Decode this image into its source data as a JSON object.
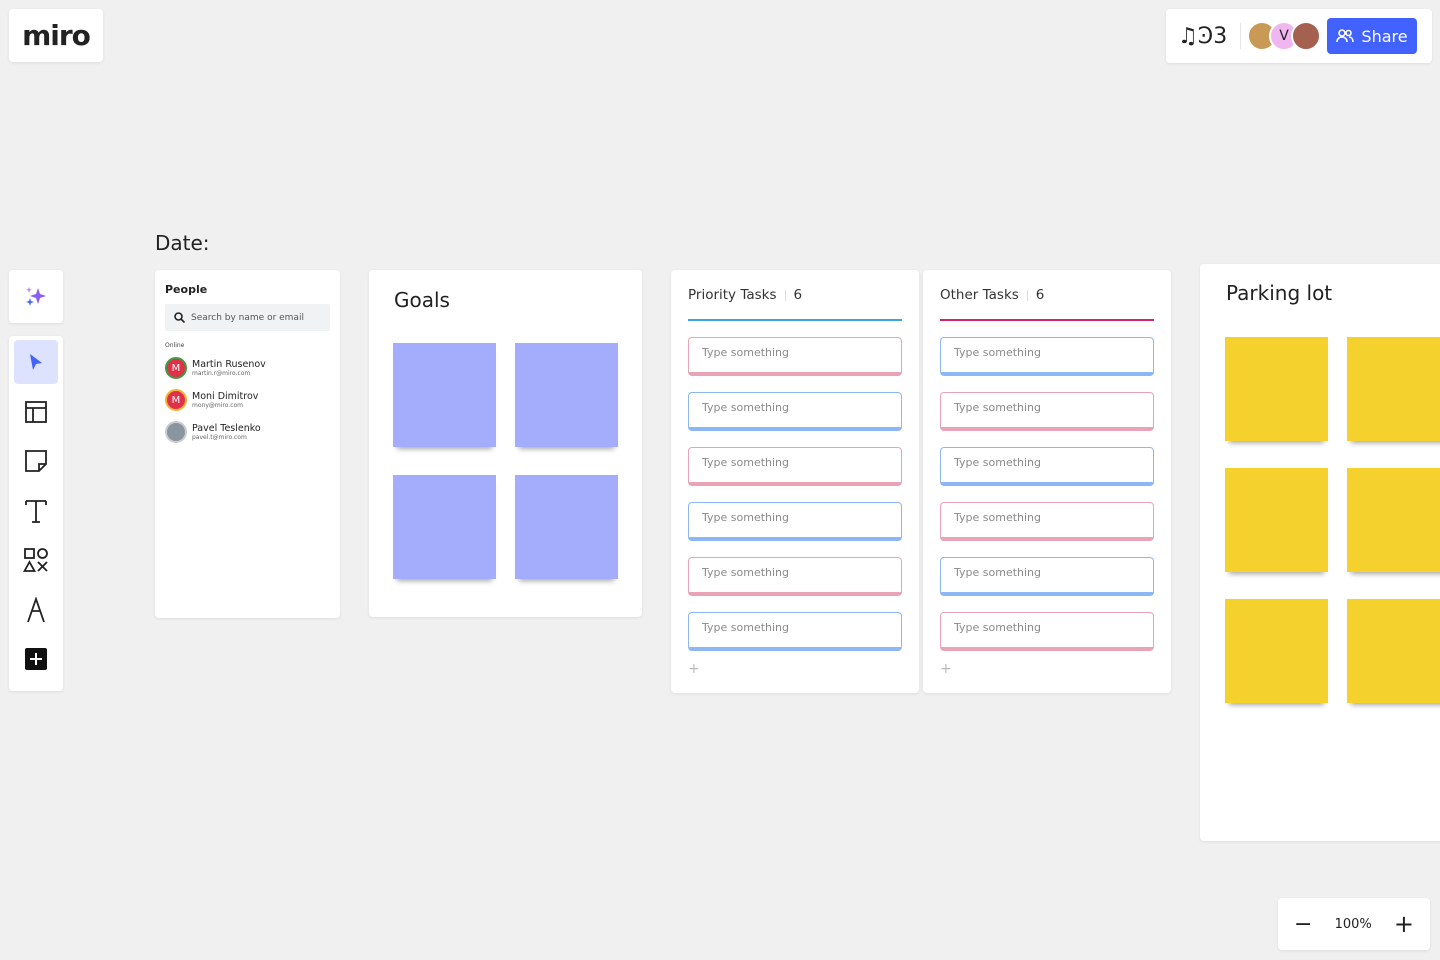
{
  "logo": "miro",
  "header": {
    "board_icon": "music-notes-board-icon",
    "avatars": [
      {
        "initial": "",
        "color": "#c99a55"
      },
      {
        "initial": "V",
        "color": "#f0b6f0"
      },
      {
        "initial": "",
        "color": "#a4614f"
      }
    ],
    "share_label": "Share",
    "accent": "#4262ff"
  },
  "toolbar": {
    "items": [
      "select",
      "templates",
      "sticky-note",
      "text",
      "shapes",
      "pen",
      "add"
    ]
  },
  "date_label": "Date:",
  "people": {
    "title": "People",
    "search_placeholder": "Search by name or email",
    "section": "Online",
    "members": [
      {
        "initial": "M",
        "name": "Martin Rusenov",
        "email": "martin.r@miro.com",
        "ring": "#3f9b3f"
      },
      {
        "initial": "M",
        "name": "Moni Dimitrov",
        "email": "mony@miro.com",
        "ring": "#f2b533"
      },
      {
        "initial": "",
        "name": "Pavel Teslenko",
        "email": "pavel.t@miro.com",
        "ring": "#ccc"
      }
    ]
  },
  "goals": {
    "title": "Goals",
    "sticky_color": "#a3adfb"
  },
  "columns": [
    {
      "title": "Priority Tasks",
      "count": "6",
      "line_color": "#3aa8e0",
      "cards": [
        {
          "text": "Type something",
          "color": "pink"
        },
        {
          "text": "Type something",
          "color": "blue"
        },
        {
          "text": "Type something",
          "color": "pink"
        },
        {
          "text": "Type something",
          "color": "blue"
        },
        {
          "text": "Type something",
          "color": "pink"
        },
        {
          "text": "Type something",
          "color": "blue"
        }
      ],
      "add": "+"
    },
    {
      "title": "Other Tasks",
      "count": "6",
      "line_color": "#d1266b",
      "cards": [
        {
          "text": "Type something",
          "color": "blue"
        },
        {
          "text": "Type something",
          "color": "pink"
        },
        {
          "text": "Type something",
          "color": "blue"
        },
        {
          "text": "Type something",
          "color": "pink"
        },
        {
          "text": "Type something",
          "color": "blue"
        },
        {
          "text": "Type something",
          "color": "pink"
        }
      ],
      "add": "+"
    }
  ],
  "parking": {
    "title": "Parking lot",
    "sticky_color": "#f5d12e"
  },
  "zoom": {
    "level": "100%",
    "minus": "−",
    "plus": "+"
  }
}
